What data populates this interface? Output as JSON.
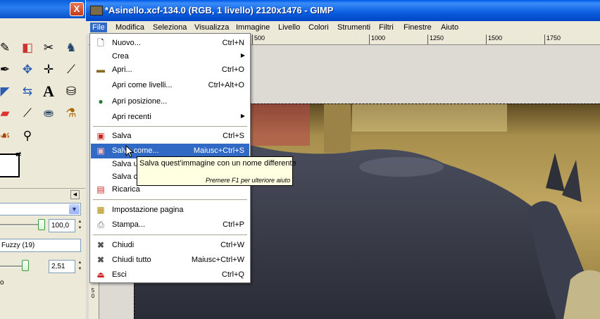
{
  "window": {
    "title": "*Asinello.xcf-134.0 (RGB, 1 livello) 2120x1476 - GIMP"
  },
  "menubar": {
    "items": [
      "File",
      "Modifica",
      "Seleziona",
      "Visualizza",
      "Immagine",
      "Livello",
      "Colori",
      "Strumenti",
      "Filtri",
      "Finestre",
      "Aiuto"
    ],
    "active": "File"
  },
  "ruler": {
    "ticks": [
      "500",
      "1000",
      "1250",
      "1500",
      "1750"
    ],
    "vertical_label": "5\n0"
  },
  "file_menu": {
    "items": [
      {
        "label": "Nuovo...",
        "shortcut": "Ctrl+N",
        "icon": "new-page-icon"
      },
      {
        "label": "Crea",
        "shortcut": "",
        "icon": "",
        "submenu": true
      },
      {
        "label": "Apri...",
        "shortcut": "Ctrl+O",
        "icon": "folder-icon"
      },
      {
        "label": "Apri come livelli...",
        "shortcut": "Ctrl+Alt+O",
        "icon": ""
      },
      {
        "label": "Apri posizione...",
        "shortcut": "",
        "icon": "globe-icon"
      },
      {
        "label": "Apri recenti",
        "shortcut": "",
        "icon": "",
        "submenu": true
      },
      {
        "label": "Salva",
        "shortcut": "Ctrl+S",
        "icon": "save-icon"
      },
      {
        "label": "Salva come...",
        "shortcut": "Maiusc+Ctrl+S",
        "icon": "save-as-icon",
        "highlighted": true
      },
      {
        "label": "Salva u",
        "shortcut": "",
        "icon": ""
      },
      {
        "label": "Salva co",
        "shortcut": "",
        "icon": ""
      },
      {
        "label": "Ricarica",
        "shortcut": "",
        "icon": "revert-icon"
      },
      {
        "label": "Impostazione pagina",
        "shortcut": "",
        "icon": "page-setup-icon"
      },
      {
        "label": "Stampa...",
        "shortcut": "Ctrl+P",
        "icon": "printer-icon"
      },
      {
        "label": "Chiudi",
        "shortcut": "Ctrl+W",
        "icon": "close-x-icon"
      },
      {
        "label": "Chiudi tutto",
        "shortcut": "Maiusc+Ctrl+W",
        "icon": "close-all-icon"
      },
      {
        "label": "Esci",
        "shortcut": "Ctrl+Q",
        "icon": "exit-icon"
      }
    ]
  },
  "tooltip": {
    "text": "Salva quest'immagine con un nome differente",
    "hint": "Premere F1 per ulteriore aiuto"
  },
  "toolbox": {
    "close_label": "X",
    "opacity_value": "100,0",
    "brush_label": "Fuzzy (19)",
    "scale_value": "2,51",
    "truncated_option": "o"
  },
  "colors": {
    "menu_highlight": "#316ac5",
    "titlebar_blue": "#0a5fd8",
    "tooltip_bg": "#ffffe1"
  }
}
